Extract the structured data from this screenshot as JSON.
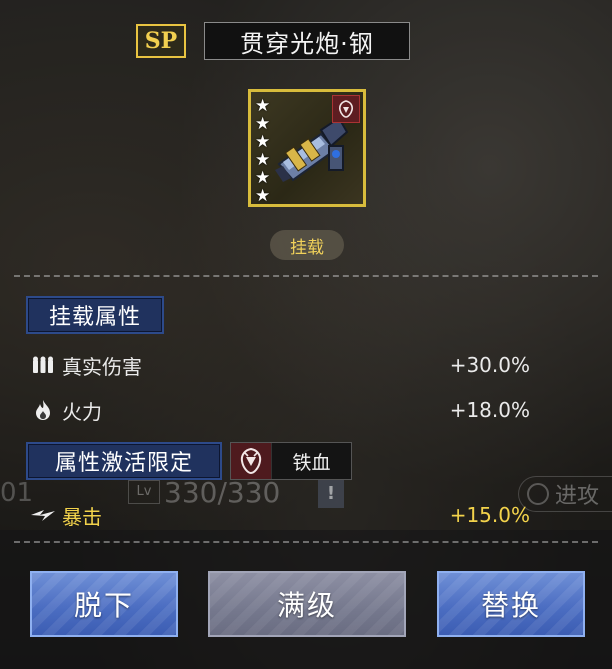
{
  "header": {
    "rarity_badge": "SP",
    "item_name": "贯穿光炮·钢"
  },
  "item": {
    "stars": 6,
    "type_label": "挂载",
    "frame_color": "#d8bc3c"
  },
  "attributes": {
    "section_label": "挂载属性",
    "stats": [
      {
        "icon": "ammo-icon",
        "label": "真实伤害",
        "value": "+30.0%"
      },
      {
        "icon": "fire-icon",
        "label": "火力",
        "value": "+18.0%"
      }
    ]
  },
  "activation": {
    "section_label": "属性激活限定",
    "faction_icon": "iron-blood-emblem-icon",
    "faction_name": "铁血",
    "stat": {
      "icon": "crit-icon",
      "label": "暴击",
      "value": "+15.0%",
      "color": "#f3d34b"
    }
  },
  "background_ui": {
    "lv_label": "Lv",
    "level_text": "330/330",
    "id_fragment": "01",
    "advance_label": "进攻",
    "alert": "!"
  },
  "actions": {
    "unequip": "脱下",
    "max_level": "满级",
    "replace": "替换"
  },
  "colors": {
    "accent_gold": "#f3d34b",
    "section_blue": "#20325e",
    "button_blue": "#4c6ec2",
    "button_gray": "#75788d"
  }
}
